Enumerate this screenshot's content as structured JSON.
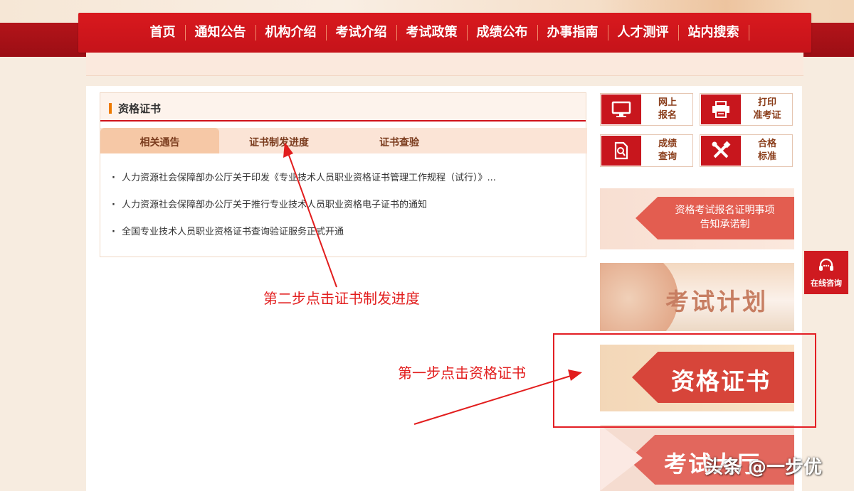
{
  "nav": {
    "items": [
      "首页",
      "通知公告",
      "机构介绍",
      "考试介绍",
      "考试政策",
      "成绩公布",
      "办事指南",
      "人才测评",
      "站内搜索"
    ]
  },
  "panel": {
    "title": "资格证书",
    "tabs": [
      "相关通告",
      "证书制发进度",
      "证书查验"
    ],
    "active_tab": 0,
    "items": [
      "人力资源社会保障部办公厅关于印发《专业技术人员职业资格证书管理工作规程（试行）》...",
      "人力资源社会保障部办公厅关于推行专业技术人员职业资格电子证书的通知",
      "全国专业技术人员职业资格证书查询验证服务正式开通"
    ]
  },
  "quick_links": [
    {
      "line1": "网上",
      "line2": "报名",
      "icon": "monitor-icon"
    },
    {
      "line1": "打印",
      "line2": "准考证",
      "icon": "printer-icon"
    },
    {
      "line1": "成绩",
      "line2": "查询",
      "icon": "document-search-icon"
    },
    {
      "line1": "合格",
      "line2": "标准",
      "icon": "tools-icon"
    }
  ],
  "banners": {
    "commitment_line1": "资格考试报名证明事项",
    "commitment_line2": "告知承诺制",
    "exam_plan": "考试计划",
    "certificate": "资格证书",
    "last_partial": "考试大厅"
  },
  "consult": {
    "label": "在线咨询",
    "icon": "headset-icon"
  },
  "annotations": {
    "step2": "第二步点击证书制发进度",
    "step1": "第一步点击资格证书"
  },
  "watermark": "头条 @一步优",
  "colors": {
    "brand_red": "#d0121a",
    "accent_orange": "#ee7b00",
    "annotation_red": "#e21d1d"
  }
}
